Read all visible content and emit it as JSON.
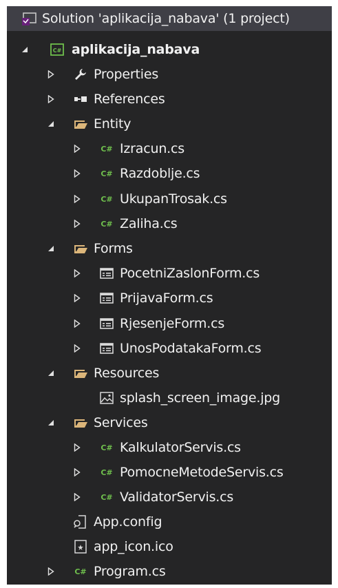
{
  "solution": {
    "label": "Solution 'aplikacija_nabava' (1 project)",
    "icon": "visual-studio-solution-icon"
  },
  "project": {
    "label": "aplikacija_nabava",
    "icon": "csharp-project-icon"
  },
  "items": {
    "properties": "Properties",
    "references": "References",
    "entity": "Entity",
    "izracun": "Izracun.cs",
    "razdoblje": "Razdoblje.cs",
    "ukupantrosak": "UkupanTrosak.cs",
    "zaliha": "Zaliha.cs",
    "forms": "Forms",
    "pocetnizaslon": "PocetniZaslonForm.cs",
    "prijava": "PrijavaForm.cs",
    "rjesenje": "RjesenjeForm.cs",
    "unospodataka": "UnosPodatakaForm.cs",
    "resources": "Resources",
    "splash": "splash_screen_image.jpg",
    "services": "Services",
    "kalkulator": "KalkulatorServis.cs",
    "pomocne": "PomocneMetodeServis.cs",
    "validator": "ValidatorServis.cs",
    "appconfig": "App.config",
    "appicon": "app_icon.ico",
    "program": "Program.cs"
  },
  "colors": {
    "background": "#252526",
    "text": "#f1f1f1",
    "csharp_green": "#6fbf4d",
    "folder": "#dcb67a",
    "selected_row": "#3f3f46"
  }
}
